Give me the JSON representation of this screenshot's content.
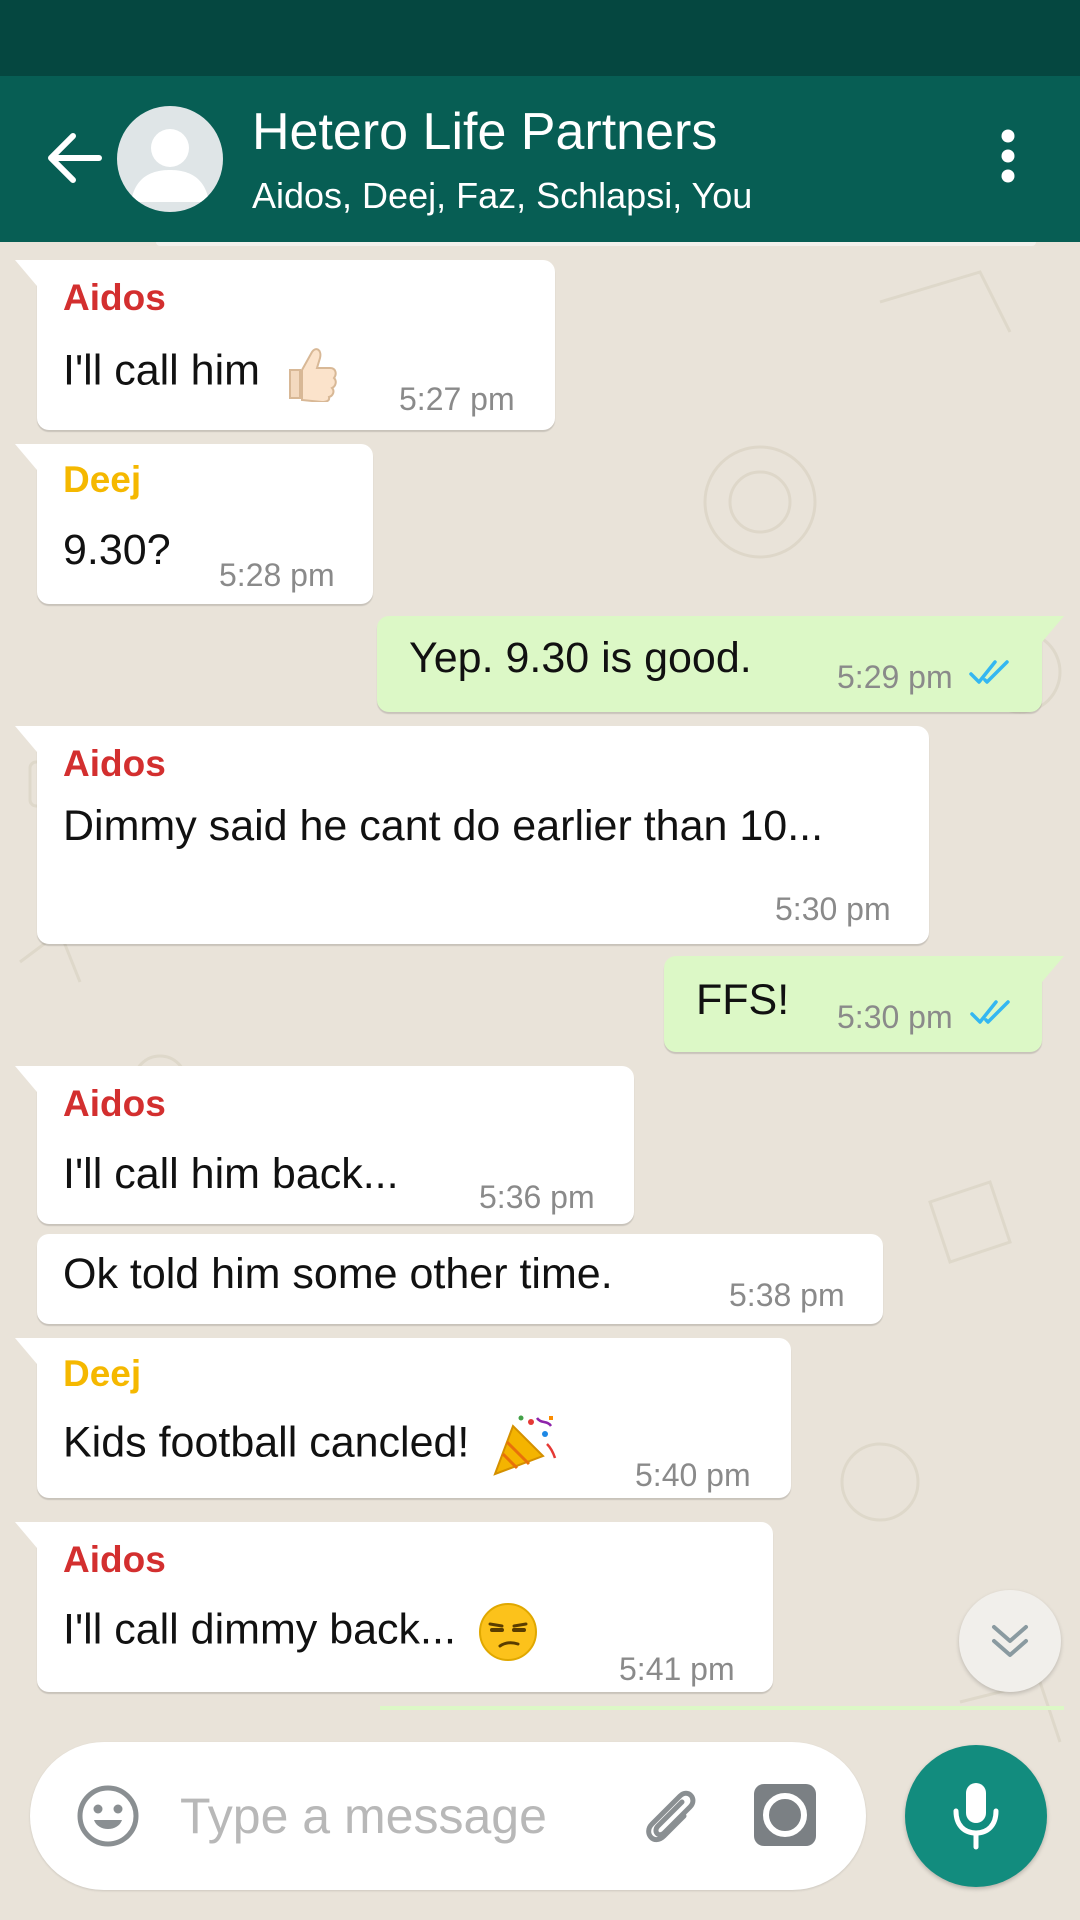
{
  "header": {
    "title": "Hetero Life Partners",
    "subtitle": "Aidos, Deej, Faz, Schlapsi, You",
    "back_icon": "arrow-left-icon",
    "avatar_icon": "group-avatar-icon",
    "menu_icon": "more-vertical-icon"
  },
  "colors": {
    "appbar": "#075e54",
    "statusbar": "#054740",
    "incoming_bubble": "#ffffff",
    "outgoing_bubble": "#dcf8c6",
    "aidos_name": "#d32f2f",
    "deej_name": "#f5b800",
    "read_ticks": "#34b7f1",
    "mic_button": "#128c7e"
  },
  "messages": [
    {
      "sender": "Aidos",
      "text": "I'll call him",
      "emoji": "thumbs-up",
      "time": "5:27 pm",
      "direction": "incoming"
    },
    {
      "sender": "Deej",
      "text": "9.30?",
      "time": "5:28 pm",
      "direction": "incoming"
    },
    {
      "text": "Yep. 9.30 is good.",
      "time": "5:29 pm",
      "direction": "outgoing",
      "status": "read"
    },
    {
      "sender": "Aidos",
      "text": "Dimmy said he cant do earlier than 10...",
      "time": "5:30 pm",
      "direction": "incoming"
    },
    {
      "text": "FFS!",
      "time": "5:30 pm",
      "direction": "outgoing",
      "status": "read"
    },
    {
      "sender": "Aidos",
      "text": "I'll call him back...",
      "time": "5:36 pm",
      "direction": "incoming"
    },
    {
      "text": "Ok told him some other time.",
      "time": "5:38 pm",
      "direction": "incoming"
    },
    {
      "sender": "Deej",
      "text": "Kids football cancled!",
      "emoji": "party-popper",
      "time": "5:40 pm",
      "direction": "incoming"
    },
    {
      "sender": "Aidos",
      "text": "I'll call dimmy back...",
      "emoji": "unamused-face",
      "time": "5:41 pm",
      "direction": "incoming"
    }
  ],
  "composer": {
    "placeholder": "Type a message",
    "value": "",
    "emoji_icon": "smiley-icon",
    "attach_icon": "paperclip-icon",
    "camera_icon": "camera-icon",
    "mic_icon": "microphone-icon"
  },
  "scroll_button_icon": "double-chevron-down-icon"
}
